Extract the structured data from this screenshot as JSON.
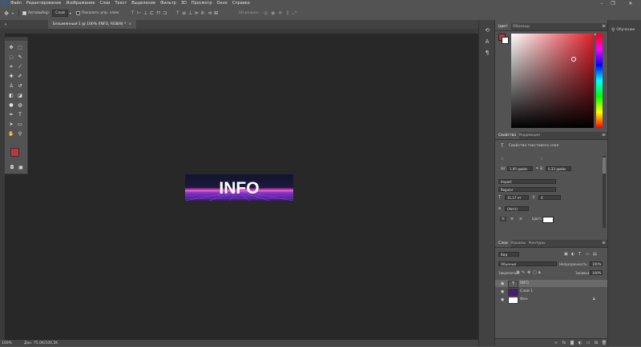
{
  "app": {
    "logo_text": "Ps"
  },
  "menu": [
    "Файл",
    "Редактирование",
    "Изображение",
    "Слои",
    "Текст",
    "Выделение",
    "Фильтр",
    "3D",
    "Просмотр",
    "Окно",
    "Справка"
  ],
  "window_controls": {
    "minimize": "–",
    "maximize": "❐",
    "close": "✕"
  },
  "options_bar": {
    "autoselect_label": "Автовыбор:",
    "autoselect_target": "Слой",
    "show_controls_label": "Показать упр. элем.",
    "mode_3d_label": "3D-режим:"
  },
  "document_tab": {
    "title": "Безымянный-1 @ 100% (INFO, RGB/8) *",
    "close": "×"
  },
  "artwork": {
    "text": "INFO",
    "colors": {
      "bg_top": "#11152c",
      "bg_bottom": "#3a1c6e",
      "glow": "#ff5bd6",
      "grid": "#a04bff"
    }
  },
  "toolbar": {
    "tools": [
      {
        "name": "move-tool-icon",
        "glyph": "✥"
      },
      {
        "name": "marquee-tool-icon",
        "glyph": "⬚"
      },
      {
        "name": "lasso-tool-icon",
        "glyph": "◌"
      },
      {
        "name": "quick-select-tool-icon",
        "glyph": "✎"
      },
      {
        "name": "crop-tool-icon",
        "glyph": "⌗"
      },
      {
        "name": "eyedropper-tool-icon",
        "glyph": "⁄"
      },
      {
        "name": "healing-tool-icon",
        "glyph": "✚"
      },
      {
        "name": "brush-tool-icon",
        "glyph": "✐"
      },
      {
        "name": "stamp-tool-icon",
        "glyph": "♙"
      },
      {
        "name": "history-brush-tool-icon",
        "glyph": "↺"
      },
      {
        "name": "eraser-tool-icon",
        "glyph": "◧"
      },
      {
        "name": "gradient-tool-icon",
        "glyph": "◪"
      },
      {
        "name": "blur-tool-icon",
        "glyph": "●"
      },
      {
        "name": "dodge-tool-icon",
        "glyph": "◍"
      },
      {
        "name": "pen-tool-icon",
        "glyph": "✒"
      },
      {
        "name": "type-tool-icon",
        "glyph": "T"
      },
      {
        "name": "path-select-tool-icon",
        "glyph": "➤"
      },
      {
        "name": "shape-tool-icon",
        "glyph": "▭"
      },
      {
        "name": "hand-tool-icon",
        "glyph": "✋"
      },
      {
        "name": "zoom-tool-icon",
        "glyph": "⚲"
      }
    ],
    "foreground_color": "#c8323c",
    "background_color": "#ffffff"
  },
  "status": {
    "zoom": "100%",
    "doc_info": "Док: 75,0K/100,5K"
  },
  "color_panel": {
    "tabs": [
      "Цвет",
      "Образцы"
    ],
    "fg": "#c8323c",
    "picker_hue": "#e0202a"
  },
  "properties_panel": {
    "tabs": [
      "Свойства",
      "Коррекция"
    ],
    "title": "Свойства текстового слоя",
    "w_label": "Ш:",
    "w_value": "1,95 дюйм",
    "h_label": "В:",
    "h_value": "0,33 дюйм",
    "x_label": "X:",
    "y_label": "Y:",
    "font_family": "Impact",
    "font_style": "Regular",
    "font_size": "31,17 пт",
    "leading": "0",
    "antialias": "(Авто)",
    "color_label": "Цвет:",
    "text_color": "#ffffff"
  },
  "layers_panel": {
    "tabs": [
      "Слои",
      "Каналы",
      "Контуры"
    ],
    "filter": "Вид",
    "blend_mode": "Обычные",
    "opacity_label": "Непрозрачность:",
    "opacity": "100%",
    "lock_label": "Закрепить:",
    "fill_label": "Заливка:",
    "fill": "100%",
    "layers": [
      {
        "name": "INFO",
        "type": "text",
        "thumb": "#5a5a5a"
      },
      {
        "name": "Слой 1",
        "type": "pixel",
        "thumb": "#4a1a7a"
      },
      {
        "name": "Фон",
        "type": "background",
        "thumb": "#ffffff"
      }
    ]
  },
  "learn_panel": {
    "label": "Обучение"
  }
}
